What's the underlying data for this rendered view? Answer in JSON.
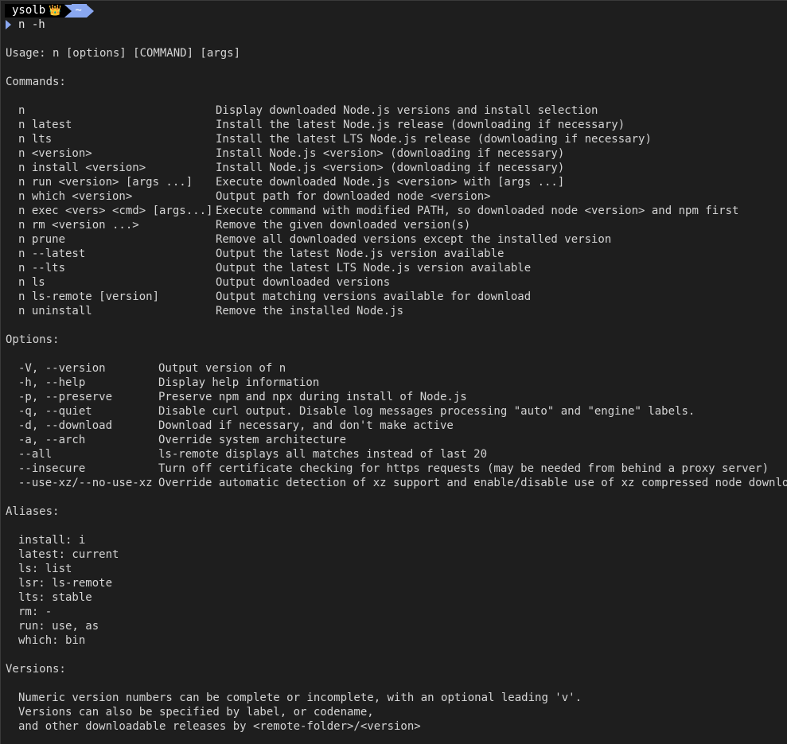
{
  "prompt": {
    "user": "ysolb",
    "crown_icon": "crown-icon",
    "dir": "~",
    "command": "n -h",
    "segment_colors": {
      "user_bg": "#000000",
      "dir_bg": "#89a7f0"
    }
  },
  "usage": "Usage: n [options] [COMMAND] [args]",
  "commands_heading": "Commands:",
  "commands": [
    {
      "cmd": "n",
      "desc": "Display downloaded Node.js versions and install selection"
    },
    {
      "cmd": "n latest",
      "desc": "Install the latest Node.js release (downloading if necessary)"
    },
    {
      "cmd": "n lts",
      "desc": "Install the latest LTS Node.js release (downloading if necessary)"
    },
    {
      "cmd": "n <version>",
      "desc": "Install Node.js <version> (downloading if necessary)"
    },
    {
      "cmd": "n install <version>",
      "desc": "Install Node.js <version> (downloading if necessary)"
    },
    {
      "cmd": "n run <version> [args ...]",
      "desc": "Execute downloaded Node.js <version> with [args ...]"
    },
    {
      "cmd": "n which <version>",
      "desc": "Output path for downloaded node <version>"
    },
    {
      "cmd": "n exec <vers> <cmd> [args...]",
      "desc": "Execute command with modified PATH, so downloaded node <version> and npm first"
    },
    {
      "cmd": "n rm <version ...>",
      "desc": "Remove the given downloaded version(s)"
    },
    {
      "cmd": "n prune",
      "desc": "Remove all downloaded versions except the installed version"
    },
    {
      "cmd": "n --latest",
      "desc": "Output the latest Node.js version available"
    },
    {
      "cmd": "n --lts",
      "desc": "Output the latest LTS Node.js version available"
    },
    {
      "cmd": "n ls",
      "desc": "Output downloaded versions"
    },
    {
      "cmd": "n ls-remote [version]",
      "desc": "Output matching versions available for download"
    },
    {
      "cmd": "n uninstall",
      "desc": "Remove the installed Node.js"
    }
  ],
  "options_heading": "Options:",
  "options": [
    {
      "opt": "-V, --version",
      "desc": "Output version of n"
    },
    {
      "opt": "-h, --help",
      "desc": "Display help information"
    },
    {
      "opt": "-p, --preserve",
      "desc": "Preserve npm and npx during install of Node.js"
    },
    {
      "opt": "-q, --quiet",
      "desc": "Disable curl output. Disable log messages processing \"auto\" and \"engine\" labels."
    },
    {
      "opt": "-d, --download",
      "desc": "Download if necessary, and don't make active"
    },
    {
      "opt": "-a, --arch",
      "desc": "Override system architecture"
    },
    {
      "opt": "--all",
      "desc": "ls-remote displays all matches instead of last 20"
    },
    {
      "opt": "--insecure",
      "desc": "Turn off certificate checking for https requests (may be needed from behind a proxy server)"
    },
    {
      "opt": "--use-xz/--no-use-xz",
      "desc": "Override automatic detection of xz support and enable/disable use of xz compressed node downloads."
    }
  ],
  "aliases_heading": "Aliases:",
  "aliases": [
    "install: i",
    "latest: current",
    "ls: list",
    "lsr: ls-remote",
    "lts: stable",
    "rm: -",
    "run: use, as",
    "which: bin"
  ],
  "versions_heading": "Versions:",
  "versions": [
    "Numeric version numbers can be complete or incomplete, with an optional leading 'v'.",
    "Versions can also be specified by label, or codename,",
    "and other downloadable releases by <remote-folder>/<version>"
  ]
}
